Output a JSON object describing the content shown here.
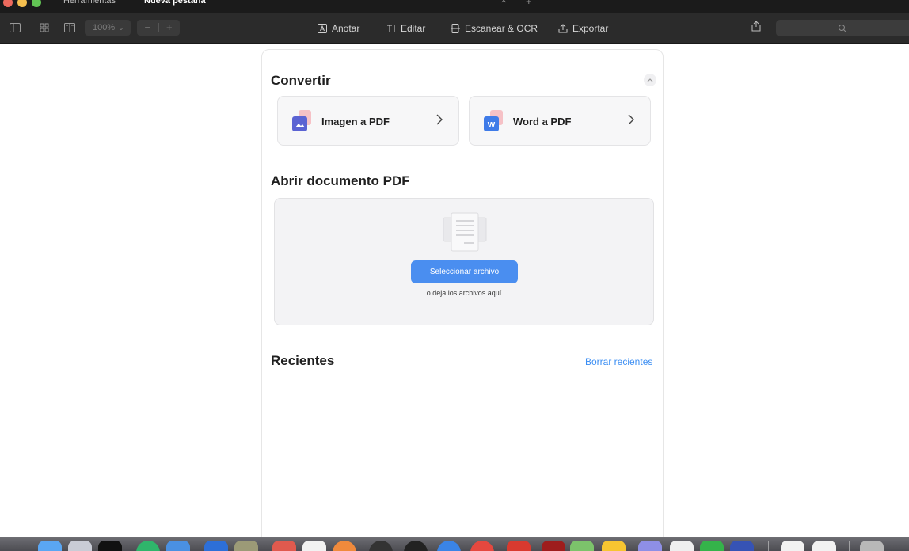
{
  "tabs": [
    {
      "label": "Herramientas"
    },
    {
      "label": "Nueva pestaña"
    }
  ],
  "toolbar": {
    "zoom": "100%",
    "tools": [
      {
        "label": "Anotar",
        "icon": "annotate-icon"
      },
      {
        "label": "Editar",
        "icon": "text-edit-icon"
      },
      {
        "label": "Escanear & OCR",
        "icon": "scan-icon"
      },
      {
        "label": "Exportar",
        "icon": "export-icon"
      }
    ]
  },
  "convert": {
    "title": "Convertir",
    "cards": [
      {
        "label": "Imagen a PDF",
        "icon": "image-file-icon"
      },
      {
        "label": "Word a PDF",
        "icon": "word-file-icon"
      }
    ]
  },
  "open_pdf": {
    "title": "Abrir documento PDF",
    "select_label": "Seleccionar archivo",
    "hint": "o deja los archivos aquí"
  },
  "recents": {
    "title": "Recientes",
    "clear_label": "Borrar recientes"
  },
  "colors": {
    "accent": "#4a8ef0",
    "link": "#3b8ef3",
    "toolbar_bg": "#2b2b2b"
  }
}
